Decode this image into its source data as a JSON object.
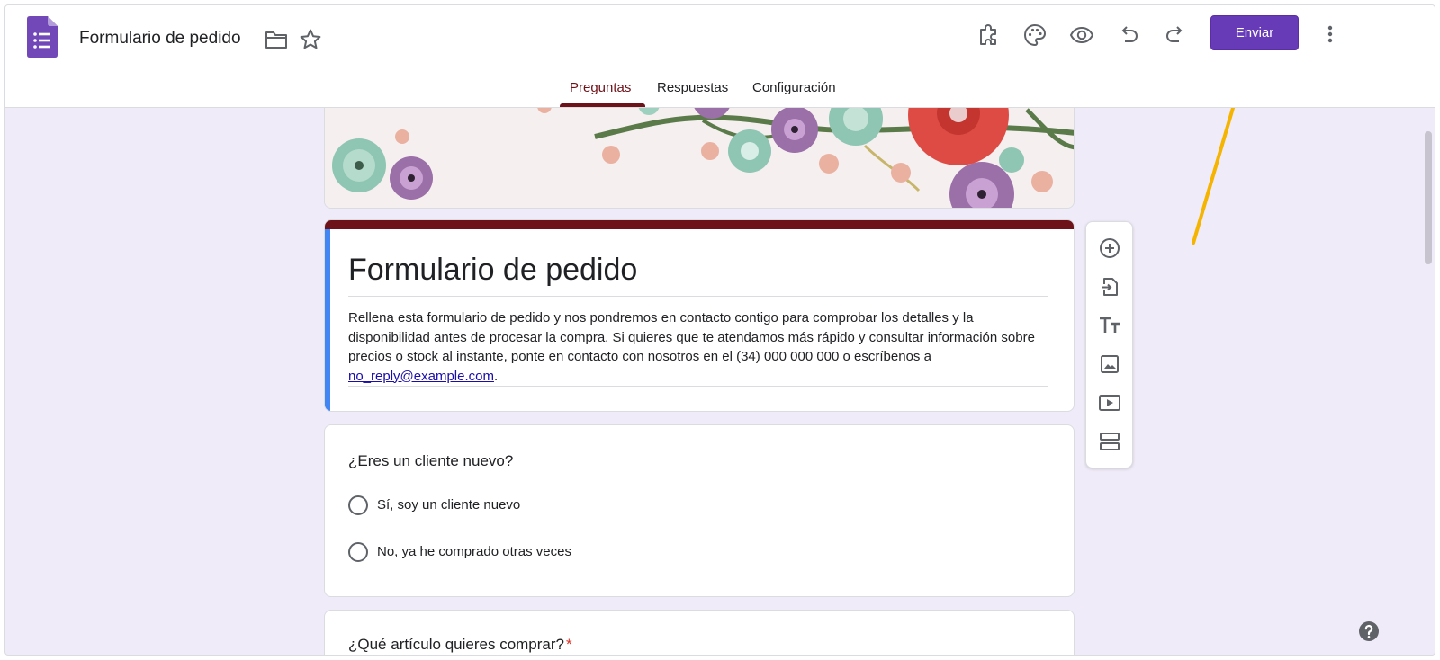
{
  "header": {
    "doc_title": "Formulario de pedido",
    "send_label": "Enviar"
  },
  "tabs": [
    {
      "label": "Preguntas",
      "active": true
    },
    {
      "label": "Respuestas",
      "active": false
    },
    {
      "label": "Configuración",
      "active": false
    }
  ],
  "toolbar_icons": [
    "puzzle-icon",
    "palette-icon",
    "eye-icon",
    "undo-icon",
    "redo-icon",
    "more-vert-icon"
  ],
  "form": {
    "title": "Formulario de pedido",
    "description_text": "Rellena esta formulario de pedido y nos pondremos en contacto contigo para comprobar los detalles y la disponibilidad antes de procesar la compra. Si quieres que te atendamos más rápido y consultar información sobre precios o stock al instante, ponte en contacto con nosotros en el (34) 000 000 000 o escríbenos a ",
    "description_email": "no_reply@example.com",
    "description_end": "."
  },
  "questions": [
    {
      "title": "¿Eres un cliente nuevo?",
      "options": [
        "Sí, soy un cliente nuevo",
        "No, ya he comprado otras veces"
      ]
    },
    {
      "title": "¿Qué artículo quieres comprar?",
      "required_mark": "*"
    }
  ],
  "side_toolbar_icons": [
    "add-question-icon",
    "import-questions-icon",
    "add-title-icon",
    "add-image-icon",
    "add-video-icon",
    "add-section-icon"
  ],
  "colors": {
    "brand": "#673ab7",
    "theme": "#6e1219",
    "accent_left_bar": "#4285f4",
    "background": "#f0ebf8",
    "annotation_arrow": "#f4b400"
  }
}
